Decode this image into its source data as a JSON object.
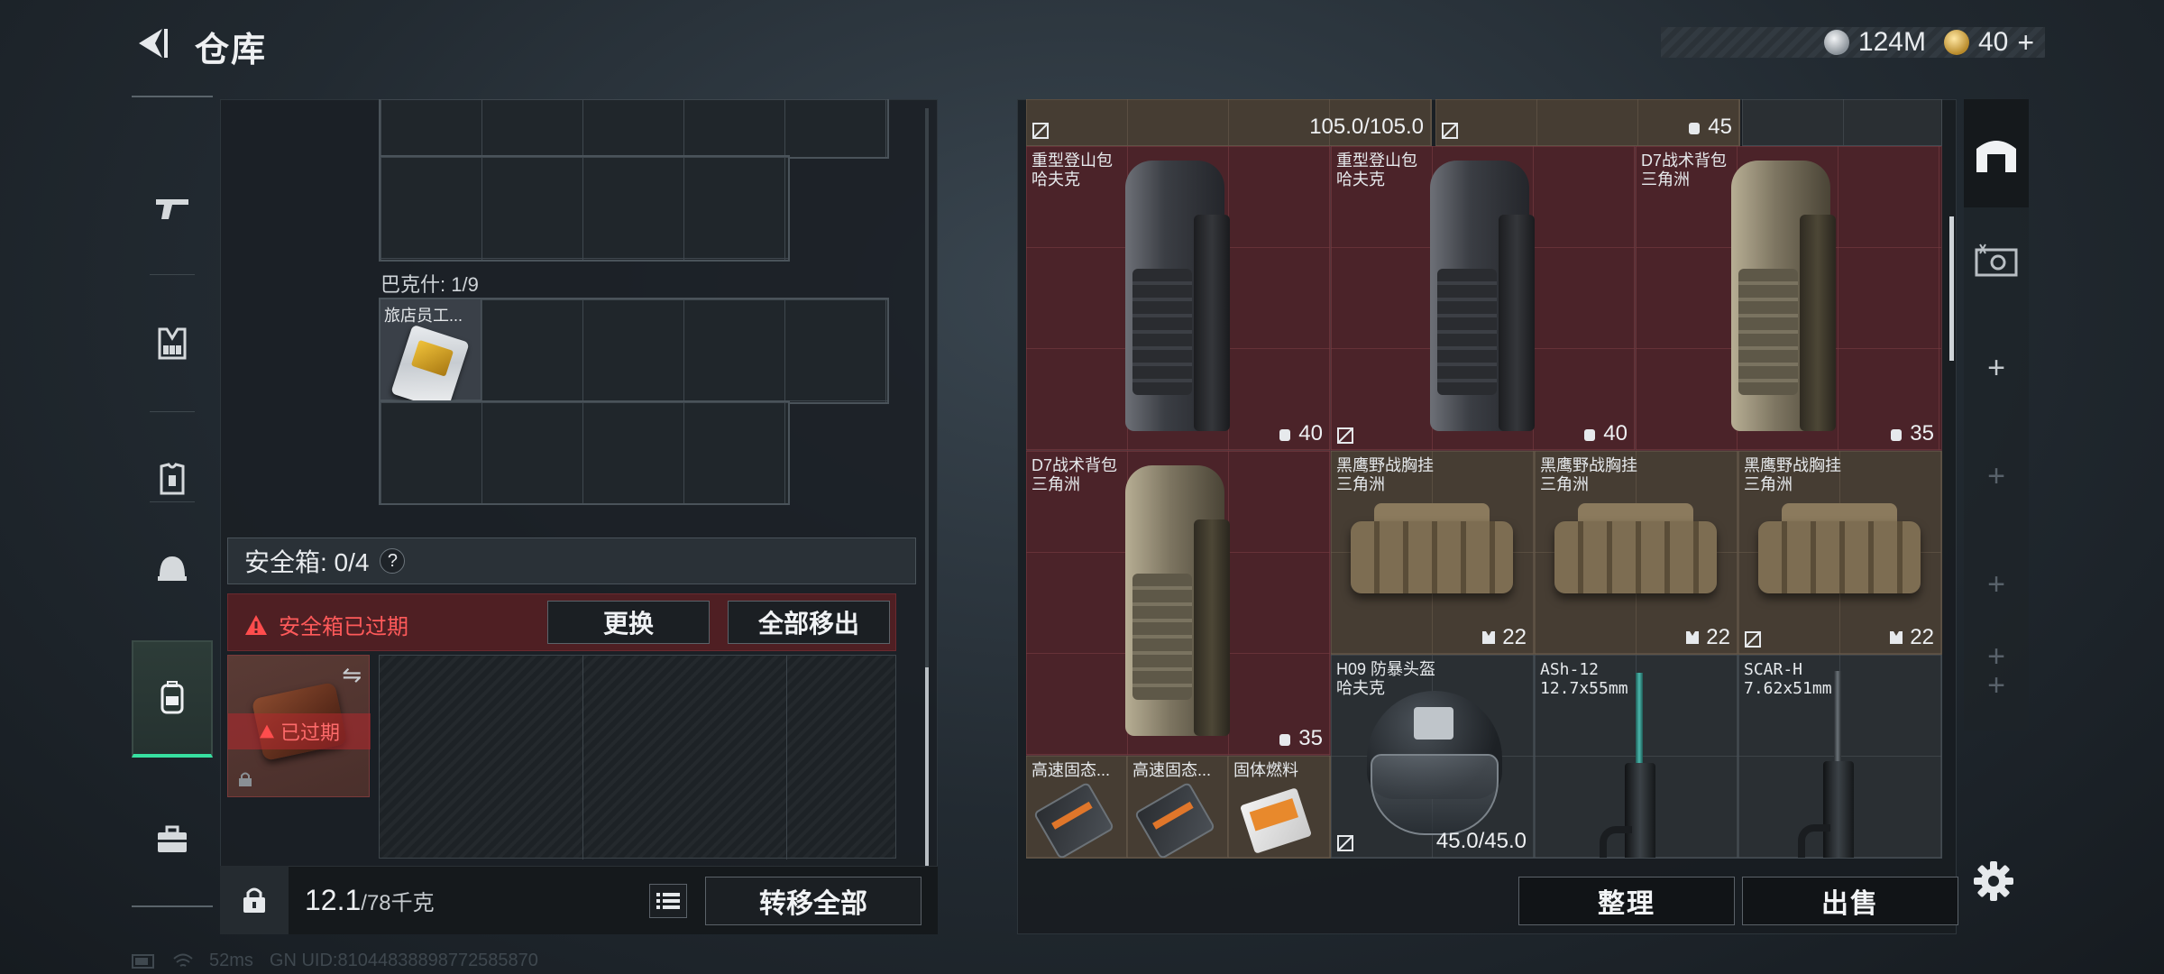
{
  "header": {
    "back_icon": "back-arrow-icon",
    "title": "仓库",
    "currencies": [
      {
        "icon": "silver-coin-icon",
        "value": "124M"
      },
      {
        "icon": "gold-coin-icon",
        "value": "40"
      }
    ],
    "add_label": "+"
  },
  "left_nav": {
    "items": [
      {
        "icon": "pistol-icon",
        "active": false
      },
      {
        "icon": "chest-rig-icon",
        "active": false
      },
      {
        "icon": "armor-icon",
        "active": false
      },
      {
        "icon": "helmet-icon",
        "active": false
      },
      {
        "icon": "backpack-icon",
        "active": true
      },
      {
        "icon": "toolbox-icon",
        "active": false
      }
    ]
  },
  "storage": {
    "container_label": "巴克什: 1/9",
    "item_name": "旅店员工...",
    "safe_box_label": "安全箱: 0/4",
    "help_label": "?",
    "expired_warning": "安全箱已过期",
    "replace_button": "更换",
    "remove_all_button": "全部移出",
    "expired_tag": "已过期",
    "swap_glyph": "⇋",
    "weight_current": "12.1",
    "weight_max": "/78千克",
    "transfer_all_button": "转移全部"
  },
  "inventory": {
    "top_row": {
      "durability": "105.0/105.0",
      "count": "45"
    },
    "items": [
      {
        "name": "重型登山包\n哈夫克",
        "value": "40",
        "color": "red"
      },
      {
        "name": "重型登山包\n哈夫克",
        "value": "40",
        "color": "red"
      },
      {
        "name": "D7战术背包\n三角洲",
        "value": "35",
        "color": "red"
      },
      {
        "name": "D7战术背包\n三角洲",
        "value": "35",
        "color": "red"
      },
      {
        "name": "黑鹰野战胸挂\n三角洲",
        "value": "22",
        "color": "tan"
      },
      {
        "name": "黑鹰野战胸挂\n三角洲",
        "value": "22",
        "color": "tan"
      },
      {
        "name": "黑鹰野战胸挂\n三角洲",
        "value": "22",
        "color": "tan"
      },
      {
        "name": "H09 防暴头盔\n哈夫克",
        "value": "45.0/45.0",
        "color": "gray"
      },
      {
        "name": "ASh-12\n12.7x55mm",
        "color": "gray"
      },
      {
        "name": "SCAR-H\n7.62x51mm",
        "color": "gray"
      },
      {
        "name": "高速固态...",
        "color": "tan"
      },
      {
        "name": "高速固态...",
        "color": "tan"
      },
      {
        "name": "固体燃料",
        "color": "tan"
      }
    ],
    "sort_button": "整理",
    "sell_button": "出售"
  },
  "side_bar": {
    "items": [
      "warehouse-icon",
      "ticket-icon",
      "add-slot",
      "add-slot",
      "add-slot",
      "add-slot",
      "add-slot"
    ],
    "settings_icon": "gear-icon"
  },
  "status_bar": {
    "ping": "52ms",
    "uid": "GN UID:8104483889877258587​0"
  }
}
